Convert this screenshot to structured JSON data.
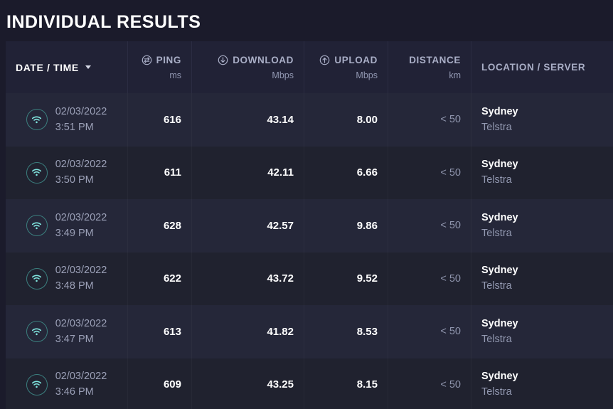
{
  "page": {
    "title": "INDIVIDUAL RESULTS",
    "background_color": "#1b1b2b",
    "row_colors": {
      "odd": "#252739",
      "even": "#20222f",
      "header": "#212236"
    },
    "accent_color": "#7fe3dd"
  },
  "table": {
    "columns": [
      {
        "key": "date_time",
        "label": "DATE / TIME",
        "unit": "",
        "icon": "sort-caret-icon",
        "align": "left",
        "sorted": true
      },
      {
        "key": "ping",
        "label": "PING",
        "unit": "ms",
        "icon": "ping-icon",
        "align": "right",
        "sorted": false
      },
      {
        "key": "download",
        "label": "DOWNLOAD",
        "unit": "Mbps",
        "icon": "download-arrow-icon",
        "align": "right",
        "sorted": false
      },
      {
        "key": "upload",
        "label": "UPLOAD",
        "unit": "Mbps",
        "icon": "upload-arrow-icon",
        "align": "right",
        "sorted": false
      },
      {
        "key": "distance",
        "label": "DISTANCE",
        "unit": "km",
        "icon": "",
        "align": "right",
        "sorted": false
      },
      {
        "key": "location",
        "label": "LOCATION / SERVER",
        "unit": "",
        "icon": "",
        "align": "left",
        "sorted": false
      }
    ],
    "rows": [
      {
        "icon": "wifi-icon",
        "date": "02/03/2022",
        "time": "3:51 PM",
        "ping": "616",
        "download": "43.14",
        "upload": "8.00",
        "distance": "< 50",
        "location": "Sydney",
        "server": "Telstra"
      },
      {
        "icon": "wifi-icon",
        "date": "02/03/2022",
        "time": "3:50 PM",
        "ping": "611",
        "download": "42.11",
        "upload": "6.66",
        "distance": "< 50",
        "location": "Sydney",
        "server": "Telstra"
      },
      {
        "icon": "wifi-icon",
        "date": "02/03/2022",
        "time": "3:49 PM",
        "ping": "628",
        "download": "42.57",
        "upload": "9.86",
        "distance": "< 50",
        "location": "Sydney",
        "server": "Telstra"
      },
      {
        "icon": "wifi-icon",
        "date": "02/03/2022",
        "time": "3:48 PM",
        "ping": "622",
        "download": "43.72",
        "upload": "9.52",
        "distance": "< 50",
        "location": "Sydney",
        "server": "Telstra"
      },
      {
        "icon": "wifi-icon",
        "date": "02/03/2022",
        "time": "3:47 PM",
        "ping": "613",
        "download": "41.82",
        "upload": "8.53",
        "distance": "< 50",
        "location": "Sydney",
        "server": "Telstra"
      },
      {
        "icon": "wifi-icon",
        "date": "02/03/2022",
        "time": "3:46 PM",
        "ping": "609",
        "download": "43.25",
        "upload": "8.15",
        "distance": "< 50",
        "location": "Sydney",
        "server": "Telstra"
      }
    ]
  }
}
